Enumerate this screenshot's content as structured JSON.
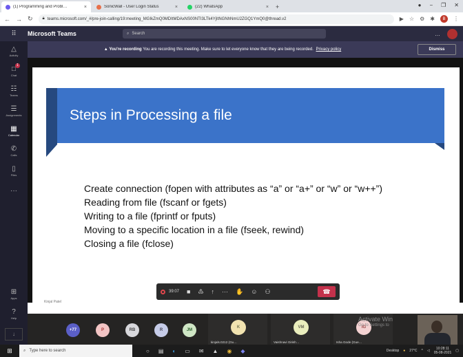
{
  "browser": {
    "tabs": [
      {
        "title": "(1) Programming and Probl…",
        "favicon_color": "#6b5aed",
        "active": true
      },
      {
        "title": "SonicWall - User Login Status",
        "favicon_color": "#e8704a",
        "active": false
      },
      {
        "title": "(22) WhatsApp",
        "favicon_color": "#25d366",
        "active": false
      }
    ],
    "new_tab": "+",
    "address": "teams.microsoft.com/_#/pre-join-calling/19:meeting_MGIkZmQ0MDItMDAxNS00NTI3LTk4YjItNGNhNmU2ZGQ1YmQ0@thread.v2",
    "profile_letter": "B"
  },
  "teams": {
    "app_title": "Microsoft Teams",
    "search_placeholder": "Search",
    "more": "…",
    "rail": [
      {
        "label": "Activity",
        "icon": "bell-icon",
        "glyph": "△"
      },
      {
        "label": "Chat",
        "icon": "chat-icon",
        "glyph": "□",
        "badge": "1"
      },
      {
        "label": "Teams",
        "icon": "teams-icon",
        "glyph": "☷"
      },
      {
        "label": "Assignments",
        "icon": "assignments-icon",
        "glyph": "☰"
      },
      {
        "label": "Calendar",
        "icon": "calendar-icon",
        "glyph": "▦"
      },
      {
        "label": "Calls",
        "icon": "phone-icon",
        "glyph": "✆"
      },
      {
        "label": "Files",
        "icon": "file-icon",
        "glyph": "▯"
      },
      {
        "label": "",
        "icon": "more-icon",
        "glyph": "···"
      }
    ],
    "rail_bottom": [
      {
        "label": "Apps",
        "icon": "apps-icon",
        "glyph": "⊞"
      },
      {
        "label": "Help",
        "icon": "help-icon",
        "glyph": "?"
      }
    ],
    "download_glyph": "↓"
  },
  "recording_banner": {
    "icon": "warning-icon",
    "bold": "You're recording",
    "message": "You are recording this meeting. Make sure to let everyone know that they are being recorded.",
    "link": "Privacy policy",
    "dismiss": "Dismiss"
  },
  "slide": {
    "title": "Steps in Processing a file",
    "bullets": [
      "Create connection (fopen with attributes as “a” or “a+” or “w” or “w++”)",
      "Reading from file (fscanf or fgets)",
      "Writing to a file (fprintf or fputs)",
      "Moving to a specific location in a file (fseek, rewind)",
      "Closing a file (fclose)"
    ],
    "accent_color": "#3b73c9"
  },
  "presenter_name": "Kinjal Patel",
  "call_controls": {
    "timer": "39:07",
    "buttons": [
      {
        "name": "camera-off-icon",
        "glyph": "■"
      },
      {
        "name": "mic-off-icon",
        "glyph": "♳"
      },
      {
        "name": "share-screen-icon",
        "glyph": "↑"
      },
      {
        "name": "more-actions-icon",
        "glyph": "···"
      },
      {
        "name": "raise-hand-icon",
        "glyph": "✋"
      },
      {
        "name": "reactions-icon",
        "glyph": "☺"
      },
      {
        "name": "participants-icon",
        "glyph": "⚇"
      }
    ],
    "leave_glyph": "☎"
  },
  "participants": {
    "overflow": {
      "text": "+77",
      "color": "#5b5fc7"
    },
    "avatars": [
      {
        "initials": "P",
        "color": "#f3c5c5"
      },
      {
        "initials": "RB",
        "color": "#d8d8dc"
      },
      {
        "initials": "R",
        "color": "#c6cce8"
      },
      {
        "initials": "JM",
        "color": "#cfe6c5"
      }
    ],
    "tiles": [
      {
        "initials": "K",
        "name": "kinjals.0212 (Gu…",
        "color": "#f1e3b0"
      },
      {
        "initials": "VM",
        "name": "Vaishnavi Girish…",
        "color": "#eaeebd"
      },
      {
        "initials": "IG",
        "name": "Isha Gode (Gue…",
        "color": "#f4d2d2"
      }
    ],
    "activate_windows": "Activate Win",
    "activate_hint": "Go to Settings to"
  },
  "taskbar": {
    "search_placeholder": "Type here to search",
    "desktop_label": "Desktop",
    "temperature": "27°C",
    "time": "10:28:11",
    "date": "05-08-2021"
  }
}
